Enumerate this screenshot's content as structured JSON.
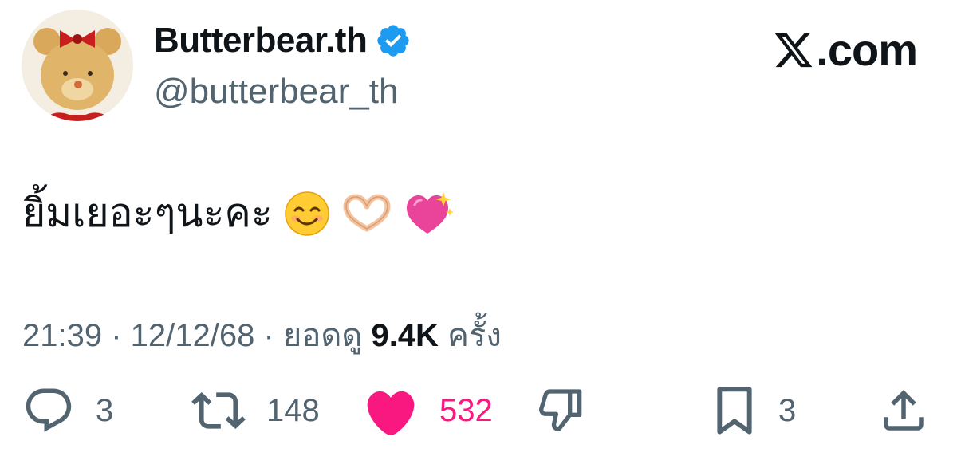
{
  "author": {
    "display_name": "Butterbear.th",
    "handle": "@butterbear_th",
    "verified_icon": "verified-badge-icon",
    "avatar_icon": "teddy-bear-avatar"
  },
  "brand": {
    "label": ".com",
    "icon": "x-logo-icon"
  },
  "tweet": {
    "text": "ยิ้มเยอะๆนะคะ",
    "emojis": [
      "smiling-face-icon",
      "heart-hands-icon",
      "sparkling-heart-icon"
    ]
  },
  "meta": {
    "time": "21:39",
    "sep1": " · ",
    "date": "12/12/68",
    "sep2": " · ",
    "views_label": "ยอดดู",
    "views_count": "9.4K",
    "views_unit": "ครั้ง"
  },
  "actions": {
    "reply_count": "3",
    "repost_count": "148",
    "like_count": "532",
    "bookmark_count": "3"
  },
  "colors": {
    "accent_blue": "#1d9bf0",
    "like_pink": "#f91880",
    "secondary_text": "#536471",
    "primary_text": "#0f1419"
  }
}
